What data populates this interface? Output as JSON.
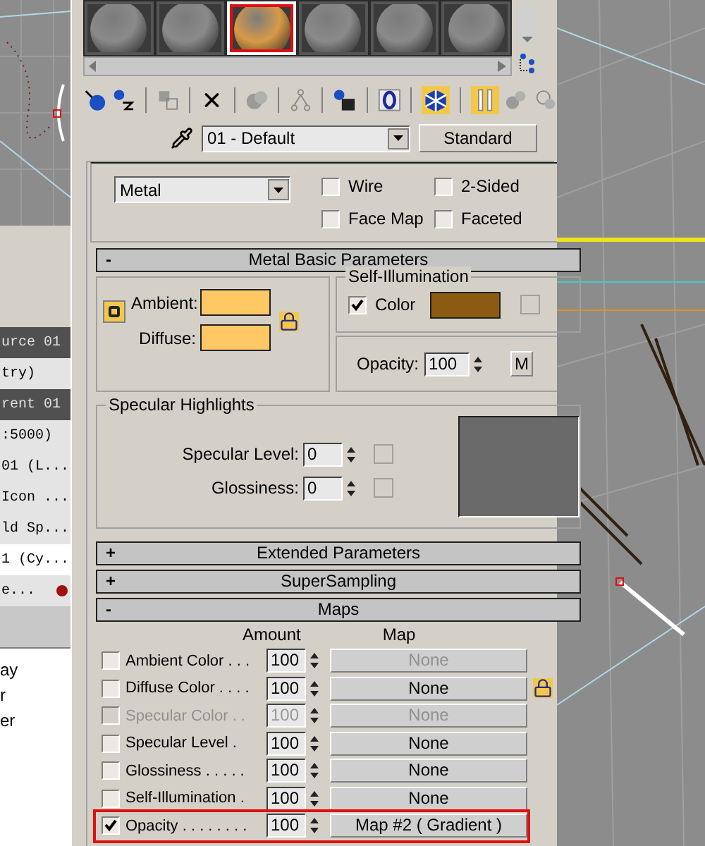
{
  "left_panel": {
    "rows": [
      {
        "text": "urce 01",
        "kind": "header",
        "selected": false
      },
      {
        "text": "try)",
        "kind": "item",
        "selected": false
      },
      {
        "text": "rent 01",
        "kind": "header",
        "selected": false
      },
      {
        "text": ":5000)",
        "kind": "item",
        "selected": false
      },
      {
        "text": "01 (L...",
        "kind": "item",
        "selected": false
      },
      {
        "text": "Icon ...",
        "kind": "item",
        "selected": false
      },
      {
        "text": "ld Sp...",
        "kind": "item",
        "selected": false
      },
      {
        "text": "1 (Cy...",
        "kind": "item",
        "selected": true
      },
      {
        "text": "e...",
        "kind": "marked",
        "selected": false
      }
    ],
    "list": [
      "ay",
      "r",
      "er"
    ]
  },
  "sample_slots": [
    {
      "color": "#8a8a8a",
      "selected": false,
      "highlighted": false
    },
    {
      "color": "#8a8a8a",
      "selected": false,
      "highlighted": false
    },
    {
      "color": "#d89a48",
      "selected": true,
      "highlighted": true
    },
    {
      "color": "#8a8a8a",
      "selected": false,
      "highlighted": false
    },
    {
      "color": "#8a8a8a",
      "selected": false,
      "highlighted": false
    },
    {
      "color": "#8a8a8a",
      "selected": false,
      "highlighted": false
    }
  ],
  "material": {
    "name": "01 - Default",
    "type": "Standard"
  },
  "shader": {
    "value": "Metal",
    "options": [
      {
        "label": "Wire",
        "checked": false
      },
      {
        "label": "2-Sided",
        "checked": false
      },
      {
        "label": "Face Map",
        "checked": false
      },
      {
        "label": "Faceted",
        "checked": false
      }
    ]
  },
  "basic_parameters": {
    "toggle": "-",
    "title": "Metal Basic Parameters",
    "ambient": {
      "label": "Ambient:",
      "color": "#ffc864"
    },
    "diffuse": {
      "label": "Diffuse:",
      "color": "#ffc864"
    },
    "self_illumination": {
      "title": "Self-Illumination",
      "label": "Color",
      "checked": true,
      "color": "#8c5a10"
    },
    "opacity": {
      "label": "Opacity:",
      "value": "100",
      "button": "M"
    },
    "specular": {
      "title": "Specular Highlights",
      "fields": [
        {
          "label": "Specular Level:",
          "value": "0"
        },
        {
          "label": "Glossiness:",
          "value": "0"
        }
      ]
    }
  },
  "collapsed_rollouts": [
    {
      "toggle": "+",
      "title": "Extended Parameters"
    },
    {
      "toggle": "+",
      "title": "SuperSampling"
    }
  ],
  "maps": {
    "toggle": "-",
    "title": "Maps",
    "columns": [
      "Amount",
      "Map"
    ],
    "rows": [
      {
        "name": "Ambient Color . . .",
        "checked": false,
        "disabled": false,
        "amount": "100",
        "map": "None",
        "map_disabled": true,
        "highlighted": false
      },
      {
        "name": "Diffuse Color . . . .",
        "checked": false,
        "disabled": false,
        "amount": "100",
        "map": "None",
        "map_disabled": false,
        "highlighted": false
      },
      {
        "name": "Specular Color . .",
        "checked": false,
        "disabled": true,
        "amount": "100",
        "map": "None",
        "map_disabled": true,
        "highlighted": false
      },
      {
        "name": "Specular Level .",
        "checked": false,
        "disabled": false,
        "amount": "100",
        "map": "None",
        "map_disabled": false,
        "highlighted": false
      },
      {
        "name": "Glossiness . . . . .",
        "checked": false,
        "disabled": false,
        "amount": "100",
        "map": "None",
        "map_disabled": false,
        "highlighted": false
      },
      {
        "name": "Self-Illumination .",
        "checked": false,
        "disabled": false,
        "amount": "100",
        "map": "None",
        "map_disabled": false,
        "highlighted": false
      },
      {
        "name": "Opacity . . . . . . . .",
        "checked": true,
        "disabled": false,
        "amount": "100",
        "map": "Map #2  ( Gradient )",
        "map_disabled": false,
        "highlighted": true
      }
    ]
  }
}
